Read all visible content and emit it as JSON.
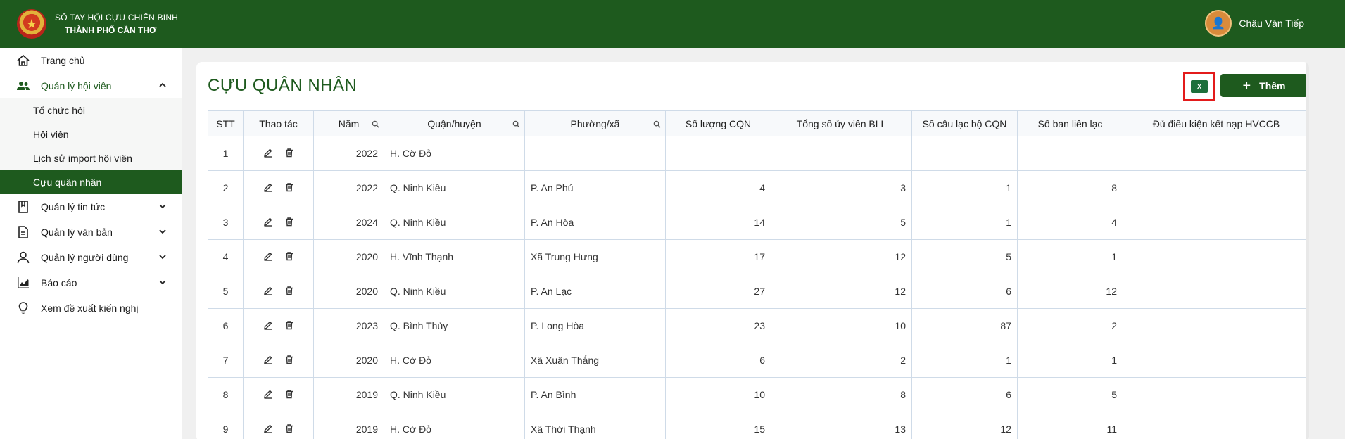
{
  "header": {
    "brand_line1": "SỔ TAY HỘI CỰU CHIẾN BINH",
    "brand_line2": "THÀNH PHỐ CẦN THƠ",
    "user_name": "Châu Văn Tiếp"
  },
  "sidebar": {
    "items": [
      {
        "label": "Trang chủ",
        "icon": "home-icon"
      },
      {
        "label": "Quản lý hội viên",
        "icon": "users-icon",
        "expanded": true
      },
      {
        "label": "Quản lý tin tức",
        "icon": "book-icon"
      },
      {
        "label": "Quản lý văn bản",
        "icon": "document-icon"
      },
      {
        "label": "Quản lý người dùng",
        "icon": "user-icon"
      },
      {
        "label": "Báo cáo",
        "icon": "chart-icon"
      },
      {
        "label": "Xem đề xuất kiến nghị",
        "icon": "lightbulb-icon"
      }
    ],
    "sub_items": [
      {
        "label": "Tổ chức hội"
      },
      {
        "label": "Hội viên"
      },
      {
        "label": "Lịch sử import hội viên"
      },
      {
        "label": "Cựu quân nhân",
        "active": true
      }
    ]
  },
  "main": {
    "title": "CỰU QUÂN NHÂN",
    "excel_label": "X",
    "add_label": "Thêm"
  },
  "table": {
    "columns": [
      "STT",
      "Thao tác",
      "Năm",
      "Quận/huyện",
      "Phường/xã",
      "Số lượng CQN",
      "Tổng số ủy viên BLL",
      "Số câu lạc bộ CQN",
      "Số ban liên lạc",
      "Đủ điều kiện kết nạp HVCCB"
    ],
    "rows": [
      {
        "stt": "1",
        "year": "2022",
        "district": "H. Cờ Đỏ",
        "ward": "",
        "cqn": "",
        "bll": "",
        "clb": "",
        "ban": "",
        "eligible": ""
      },
      {
        "stt": "2",
        "year": "2022",
        "district": "Q. Ninh Kiều",
        "ward": "P. An Phú",
        "cqn": "4",
        "bll": "3",
        "clb": "1",
        "ban": "8",
        "eligible": ""
      },
      {
        "stt": "3",
        "year": "2024",
        "district": "Q. Ninh Kiều",
        "ward": "P. An Hòa",
        "cqn": "14",
        "bll": "5",
        "clb": "1",
        "ban": "4",
        "eligible": ""
      },
      {
        "stt": "4",
        "year": "2020",
        "district": "H. Vĩnh Thạnh",
        "ward": "Xã Trung Hưng",
        "cqn": "17",
        "bll": "12",
        "clb": "5",
        "ban": "1",
        "eligible": ""
      },
      {
        "stt": "5",
        "year": "2020",
        "district": "Q. Ninh Kiều",
        "ward": "P. An Lạc",
        "cqn": "27",
        "bll": "12",
        "clb": "6",
        "ban": "12",
        "eligible": ""
      },
      {
        "stt": "6",
        "year": "2023",
        "district": "Q. Bình Thủy",
        "ward": "P. Long Hòa",
        "cqn": "23",
        "bll": "10",
        "clb": "87",
        "ban": "2",
        "eligible": ""
      },
      {
        "stt": "7",
        "year": "2020",
        "district": "H. Cờ Đỏ",
        "ward": "Xã Xuân Thắng",
        "cqn": "6",
        "bll": "2",
        "clb": "1",
        "ban": "1",
        "eligible": ""
      },
      {
        "stt": "8",
        "year": "2019",
        "district": "Q. Ninh Kiều",
        "ward": "P. An Bình",
        "cqn": "10",
        "bll": "8",
        "clb": "6",
        "ban": "5",
        "eligible": ""
      },
      {
        "stt": "9",
        "year": "2019",
        "district": "H. Cờ Đỏ",
        "ward": "Xã Thới Thạnh",
        "cqn": "15",
        "bll": "13",
        "clb": "12",
        "ban": "11",
        "eligible": ""
      }
    ]
  },
  "colors": {
    "brand": "#1e5a1e",
    "highlight": "#e31b1b",
    "excel": "#1d6f3b"
  }
}
